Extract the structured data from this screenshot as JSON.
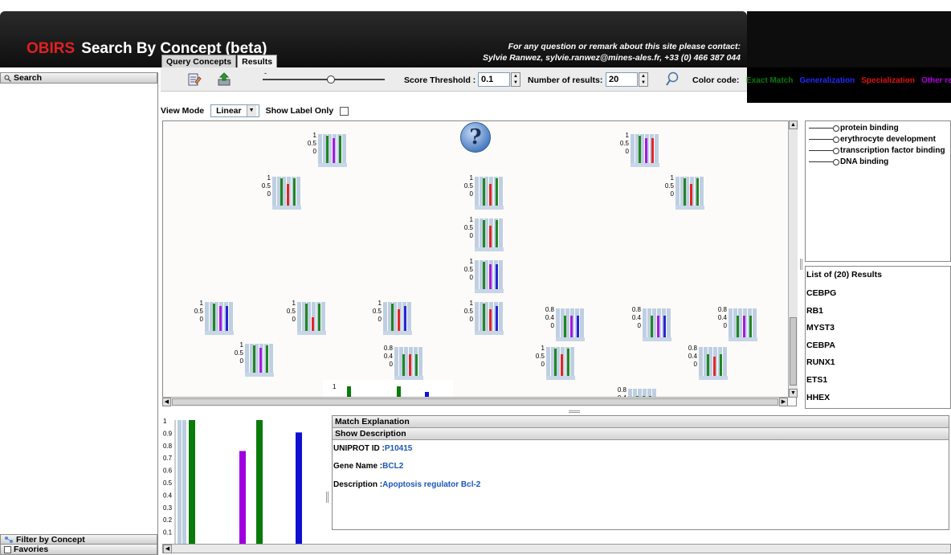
{
  "header": {
    "brand": "OBIRS",
    "title": "Search By Concept (beta)",
    "contact_line1": "For any question or remark about this site please contact:",
    "contact_line2": "Sylvie Ranwez, sylvie.ranwez@mines-ales.fr, +33 (0) 466 387 044"
  },
  "tabs": [
    {
      "label": "Query Concepts",
      "active": false
    },
    {
      "label": "Results",
      "active": true
    }
  ],
  "left_panel": {
    "search_label": "Search",
    "filter_label": "Filter by Concept",
    "favorites_label": "Favories"
  },
  "toolbar": {
    "score_threshold_label": "Score Threshold :",
    "score_threshold_value": "0.1",
    "num_results_label": "Number of results:",
    "num_results_value": "20",
    "color_code_label": "Color code:",
    "slider_level": 0.56,
    "color_codes": [
      {
        "label": "Exact Match",
        "color": "#0a7a0a"
      },
      {
        "label": "Generalization",
        "color": "#2626ff"
      },
      {
        "label": "Specialization",
        "color": "#e01010"
      },
      {
        "label": "Other re",
        "color": "#b000e0"
      }
    ]
  },
  "view": {
    "mode_label": "View Mode",
    "mode_value": "Linear",
    "show_label_only": "Show Label Only"
  },
  "legend": {
    "items": [
      "protein binding",
      "erythrocyte development",
      "transcription factor binding",
      "DNA binding"
    ]
  },
  "results": {
    "header": "List of (20) Results",
    "items": [
      "CEBPG",
      "RB1",
      "MYST3",
      "CEBPA",
      "RUNX1",
      "ETS1",
      "HHEX"
    ]
  },
  "node_ticks": {
    "a": [
      "1",
      "0.5",
      "0"
    ],
    "b": [
      "0.8",
      "0.4",
      "0"
    ]
  },
  "bottom_chart": {
    "yticks": [
      "1",
      "0.9",
      "0.8",
      "0.7",
      "0.6",
      "0.5",
      "0.4",
      "0.3",
      "0.2",
      "0.1"
    ]
  },
  "chart_data": {
    "type": "bar",
    "categories": [
      "protein binding",
      "erythrocyte development",
      "transcription factor binding",
      "DNA binding"
    ],
    "values": [
      1.0,
      0.75,
      1.0,
      0.9
    ],
    "colors": [
      "#0a7a0a",
      "#a000e0",
      "#0a7a0a",
      "#1010d0"
    ],
    "ylim": [
      0,
      1
    ],
    "yticks": [
      1,
      0.9,
      0.8,
      0.7,
      0.6,
      0.5,
      0.4,
      0.3,
      0.2,
      0.1
    ]
  },
  "detail": {
    "match_explanation": "Match Explanation",
    "show_description": "Show Description",
    "uniprot_label": "UNIPROT ID :",
    "uniprot_value": "P10415",
    "gene_label": "Gene Name :",
    "gene_value": "BCL2",
    "desc_label": "Description :",
    "desc_value": "Apoptosis regulator Bcl-2"
  }
}
